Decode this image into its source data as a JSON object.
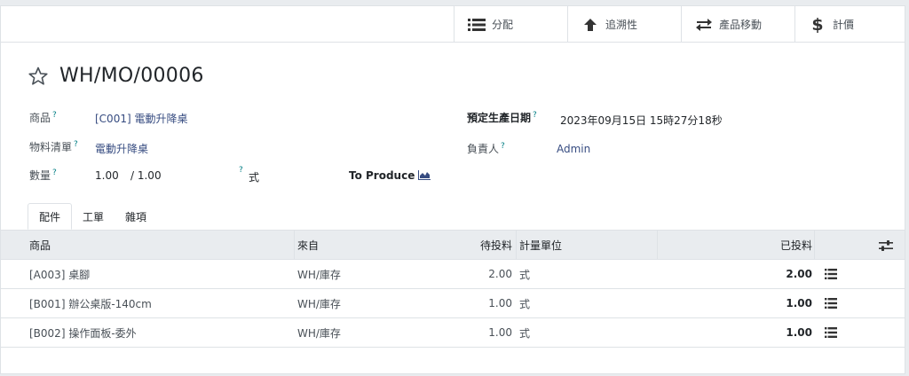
{
  "smart_buttons": {
    "allocation": "分配",
    "traceability": "追溯性",
    "product_moves": "產品移動",
    "costing": "計價"
  },
  "record": {
    "title": "WH/MO/00006"
  },
  "fields": {
    "product_label": "商品",
    "product_value": "[C001] 電動升降桌",
    "bom_label": "物料清單",
    "bom_value": "電動升降桌",
    "quantity_label": "數量",
    "quantity_value": "1.00",
    "quantity_total": "/ 1.00",
    "uom_value": "式",
    "to_produce": "To Produce",
    "scheduled_label": "預定生產日期",
    "scheduled_value": "2023年09月15日 15時27分18秒",
    "responsible_label": "負責人",
    "responsible_value": "Admin",
    "help_mark": "?"
  },
  "tabs": [
    "配件",
    "工單",
    "雜項"
  ],
  "table": {
    "headers": {
      "product": "商品",
      "source": "來自",
      "to_consume": "待投料",
      "uom": "計量單位",
      "consumed": "已投料"
    },
    "rows": [
      {
        "product": "[A003] 桌腳",
        "source": "WH/庫存",
        "to_consume": "2.00",
        "uom": "式",
        "consumed": "2.00"
      },
      {
        "product": "[B001] 辦公桌版-140cm",
        "source": "WH/庫存",
        "to_consume": "1.00",
        "uom": "式",
        "consumed": "1.00"
      },
      {
        "product": "[B002] 操作面板-委外",
        "source": "WH/庫存",
        "to_consume": "1.00",
        "uom": "式",
        "consumed": "1.00"
      }
    ]
  }
}
